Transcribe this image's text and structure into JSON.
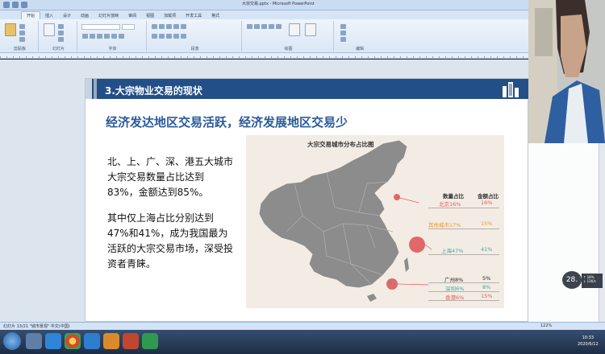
{
  "window": {
    "title": "大宗交易.pptx - Microsoft PowerPoint"
  },
  "ribbon_tabs": [
    "开始",
    "插入",
    "设计",
    "动画",
    "幻灯片放映",
    "审阅",
    "视图",
    "加载项",
    "开发工具",
    "格式"
  ],
  "ribbon_groups": [
    "剪贴板",
    "幻灯片",
    "字体",
    "段落",
    "绘图",
    "编辑"
  ],
  "slide": {
    "section_title": "3.大宗物业交易的现状",
    "subtitle": "经济发达地区交易活跃，经济发展地区交易少",
    "paragraph1": "北、上、广、深、港五大城市大宗交易数量占比达到83%，金额达到85%。",
    "paragraph2": "其中仅上海占比分别达到47%和41%，成为我国最为活跃的大宗交易市场，深受投资者青睐。"
  },
  "chart_data": {
    "type": "table",
    "title": "大宗交易城市分布占比图",
    "columns": [
      "数量占比",
      "金额占比"
    ],
    "rows": [
      {
        "city_label": "北京16%",
        "amount": "16%"
      },
      {
        "city_label": "其他城市17%",
        "amount": "15%"
      },
      {
        "city_label": "上海47%",
        "amount": "41%"
      },
      {
        "city_label": "广州8%",
        "amount": "5%"
      },
      {
        "city_label": "深圳6%",
        "amount": "8%"
      },
      {
        "city_label": "香港6%",
        "amount": "15%"
      }
    ],
    "colors": {
      "highlight_red": "#e05a5a",
      "highlight_teal": "#3fa7a1",
      "highlight_orange": "#e8962f",
      "header_blue": "#224f87"
    }
  },
  "overlay": {
    "zoom_badge": "28.",
    "net_stats": [
      "↑ 18%",
      "↓ 12K/s"
    ]
  },
  "statusbar": {
    "text": "幻灯片 13/21   \"城市景观\"   中文(中国)",
    "zoom": "122%"
  },
  "taskbar": {
    "clock_time": "10:33",
    "clock_date": "2020/6/12"
  }
}
